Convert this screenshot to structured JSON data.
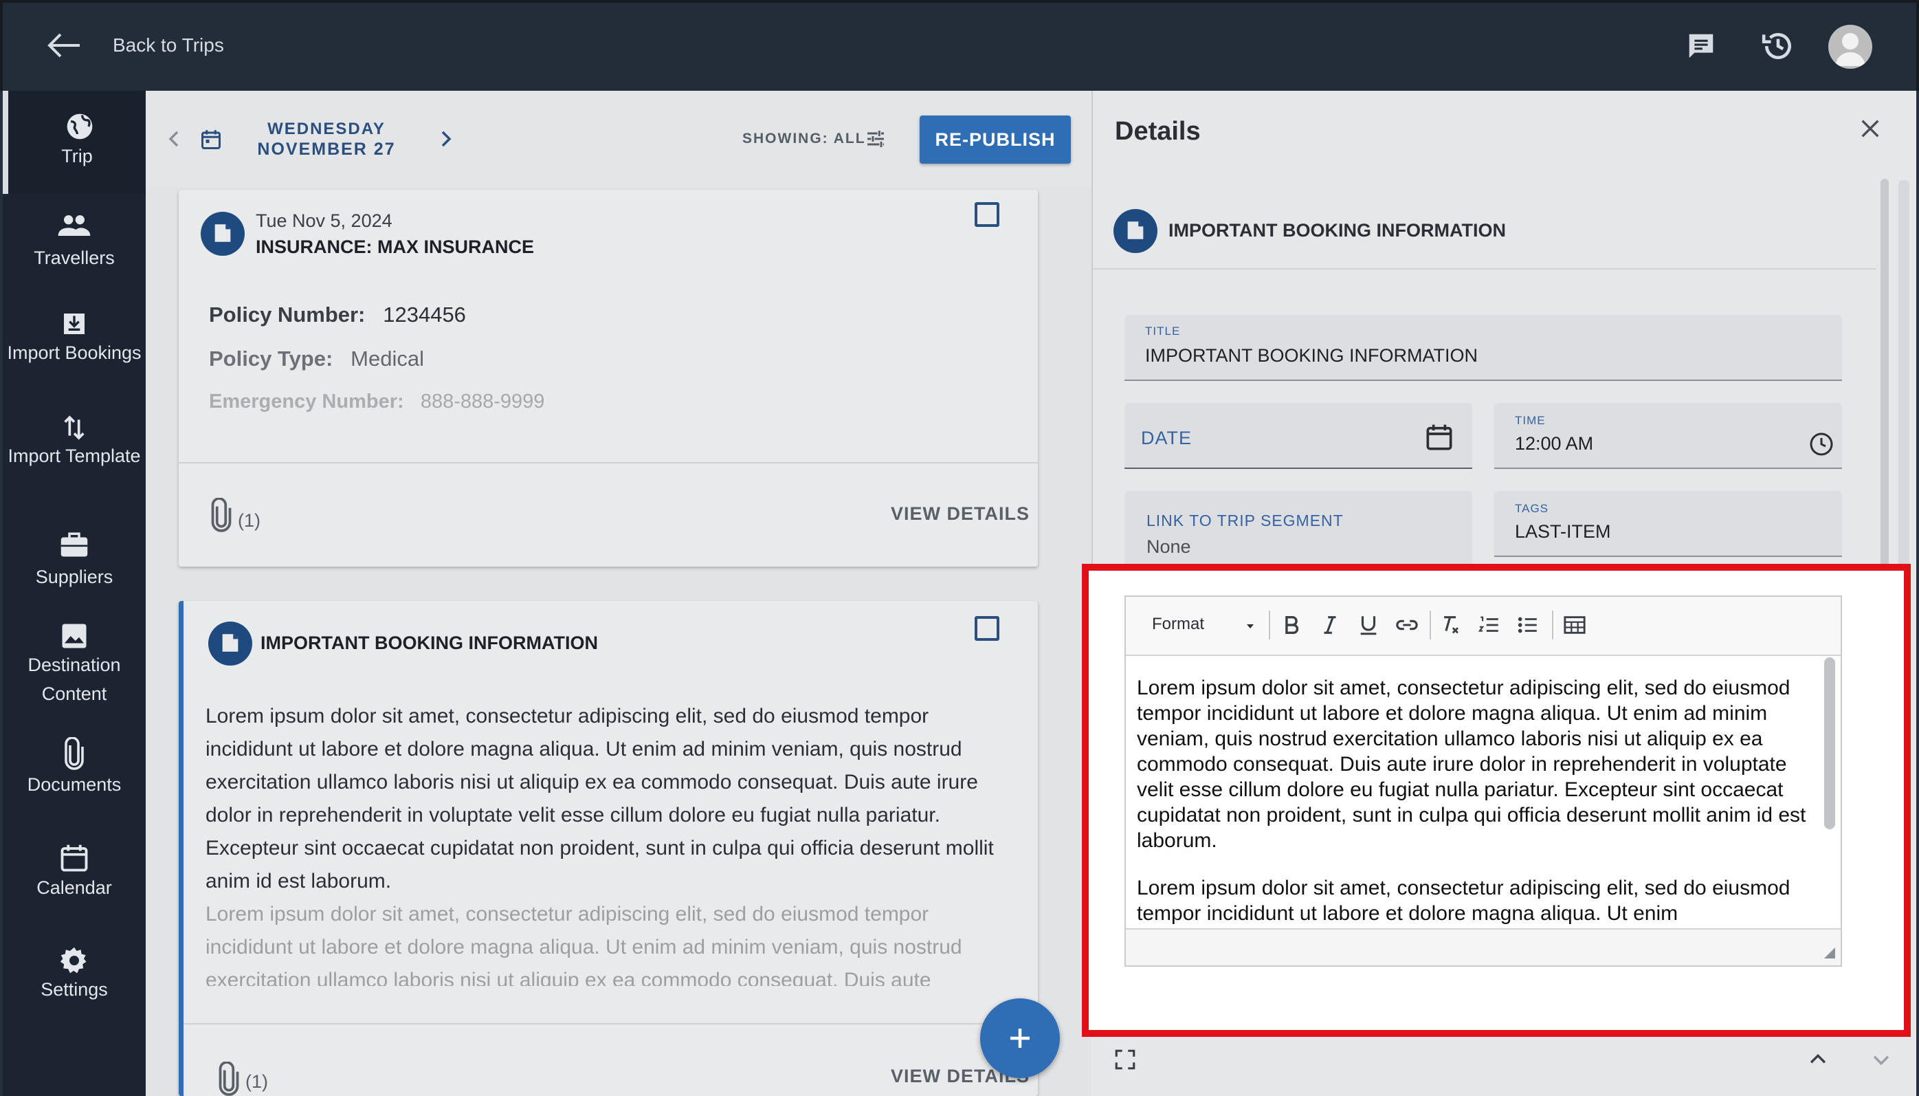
{
  "header": {
    "back_label": "Back to Trips",
    "icons": [
      "back-arrow-icon",
      "chat-icon",
      "history-icon",
      "avatar"
    ]
  },
  "sidebar": {
    "items": [
      {
        "label": "Trip",
        "icon": "globe-icon",
        "active": true
      },
      {
        "label": "Travellers",
        "icon": "people-icon"
      },
      {
        "label": "Import Bookings",
        "icon": "import-icon"
      },
      {
        "label": "Import Template",
        "icon": "swap-vertical-icon"
      },
      {
        "label": "Suppliers",
        "icon": "briefcase-icon"
      },
      {
        "label": "Destination Content",
        "icon": "image-icon"
      },
      {
        "label": "Documents",
        "icon": "paperclip-icon"
      },
      {
        "label": "Calendar",
        "icon": "calendar-icon"
      },
      {
        "label": "Settings",
        "icon": "gear-icon"
      }
    ]
  },
  "datebar": {
    "weekday": "WEDNESDAY",
    "day": "NOVEMBER 27",
    "showing": "SHOWING: ALL",
    "republish": "RE-PUBLISH"
  },
  "cards": [
    {
      "date": "Tue Nov 5, 2024",
      "title": "INSURANCE: MAX INSURANCE",
      "fields": [
        {
          "label": "Policy Number:",
          "value": "1234456"
        },
        {
          "label": "Policy Type:",
          "value": "Medical"
        },
        {
          "label": "Emergency Number:",
          "value": "888-888-9999"
        }
      ],
      "attachments": "(1)",
      "action": "VIEW DETAILS"
    },
    {
      "title": "IMPORTANT BOOKING INFORMATION",
      "body": "Lorem ipsum dolor sit amet, consectetur adipiscing elit, sed do eiusmod tempor incididunt ut labore et dolore magna aliqua. Ut enim ad minim veniam, quis nostrud exercitation ullamco laboris nisi ut aliquip ex ea commodo consequat. Duis aute irure dolor in reprehenderit in voluptate velit esse cillum dolore eu fugiat nulla pariatur. Excepteur sint occaecat cupidatat non proident, sunt in culpa qui officia deserunt mollit anim id est laborum.",
      "body2": "Lorem ipsum dolor sit amet, consectetur adipiscing elit, sed do eiusmod tempor incididunt ut labore et dolore magna aliqua. Ut enim ad minim veniam, quis nostrud exercitation ullamco laboris nisi ut aliquip ex ea commodo consequat. Duis aute",
      "attachments": "(1)",
      "action": "VIEW DETAILS"
    }
  ],
  "details": {
    "title": "Details",
    "item_heading": "IMPORTANT BOOKING INFORMATION",
    "title_field": {
      "label": "TITLE",
      "value": "IMPORTANT BOOKING INFORMATION"
    },
    "date_field": {
      "label": "DATE",
      "value": ""
    },
    "time_field": {
      "label": "TIME",
      "value": "12:00 AM"
    },
    "segment_field": {
      "label": "LINK TO TRIP SEGMENT",
      "value": "None"
    },
    "tags_field": {
      "label": "TAGS",
      "value": "LAST-ITEM"
    },
    "editor": {
      "format_label": "Format",
      "toolbar": [
        "bold-icon",
        "italic-icon",
        "underline-icon",
        "link-icon",
        "clear-format-icon",
        "numbered-list-icon",
        "bulleted-list-icon",
        "table-icon"
      ],
      "paragraph1": "Lorem ipsum dolor sit amet, consectetur adipiscing elit, sed do eiusmod tempor incididunt ut labore et dolore magna aliqua. Ut enim ad minim veniam, quis nostrud exercitation ullamco laboris nisi ut aliquip ex ea commodo consequat. Duis aute irure dolor in reprehenderit in voluptate velit esse cillum dolore eu fugiat nulla pariatur. Excepteur sint occaecat cupidatat non proident, sunt in culpa qui officia deserunt mollit anim id est laborum.",
      "paragraph2": "Lorem ipsum dolor sit amet, consectetur adipiscing elit, sed do eiusmod tempor incididunt ut labore et dolore magna aliqua. Ut enim"
    },
    "highlight_color": "#e10f17"
  },
  "colors": {
    "topbar": "#232c39",
    "sidebar": "#1b2430",
    "accent": "#2f6db5",
    "heading_blue": "#2a4f7e"
  }
}
